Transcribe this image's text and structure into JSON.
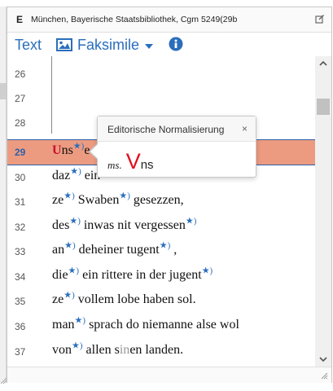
{
  "header": {
    "siglum": "E",
    "manuscript": "München, Bayerische Staatsbibliothek, Cgm 5249(29b",
    "edit_icon": "edit-square-icon"
  },
  "toolbar": {
    "text_tab": "Text",
    "facsimile_tab": "Faksimile",
    "facsimile_icon": "image-icon",
    "info_icon": "info-icon"
  },
  "lines": [
    {
      "num": "26"
    },
    {
      "num": "27"
    },
    {
      "num": "28"
    },
    {
      "num": "29",
      "first_letter": "U",
      "rest": "ns",
      "after": "e"
    },
    {
      "num": "30",
      "t1": "daz",
      "t2": " ein"
    },
    {
      "num": "31",
      "t1": "ze",
      "t2": " Swaben",
      "t3": " gesezzen,"
    },
    {
      "num": "32",
      "t1": "des",
      "t2": " inwas nit vergessen"
    },
    {
      "num": "33",
      "t1": "an",
      "t2": " deheiner tugent",
      "t3": " ,"
    },
    {
      "num": "34",
      "t1": "die",
      "t2": " ein rittere in der jugent"
    },
    {
      "num": "35",
      "t1": "ze",
      "t2": " vollem lobe haben sol."
    },
    {
      "num": "36",
      "t1": "man",
      "t2": " sprach do niemanne alse wol"
    },
    {
      "num": "37",
      "t1": "von",
      "t2": " allen s",
      "t2gray": "in",
      "t3": "en landen."
    }
  ],
  "star_symbol": "★)",
  "popover": {
    "title": "Editorische Normalisierung",
    "close": "×",
    "ms_label": "ms.",
    "initial": "V",
    "rest": "ns"
  },
  "colors": {
    "accent": "#2a6ebb",
    "highlight": "#ec9b80",
    "highlight_border": "#2f5fa8",
    "initial_red": "#c8102e",
    "popover_red": "#e01020"
  }
}
